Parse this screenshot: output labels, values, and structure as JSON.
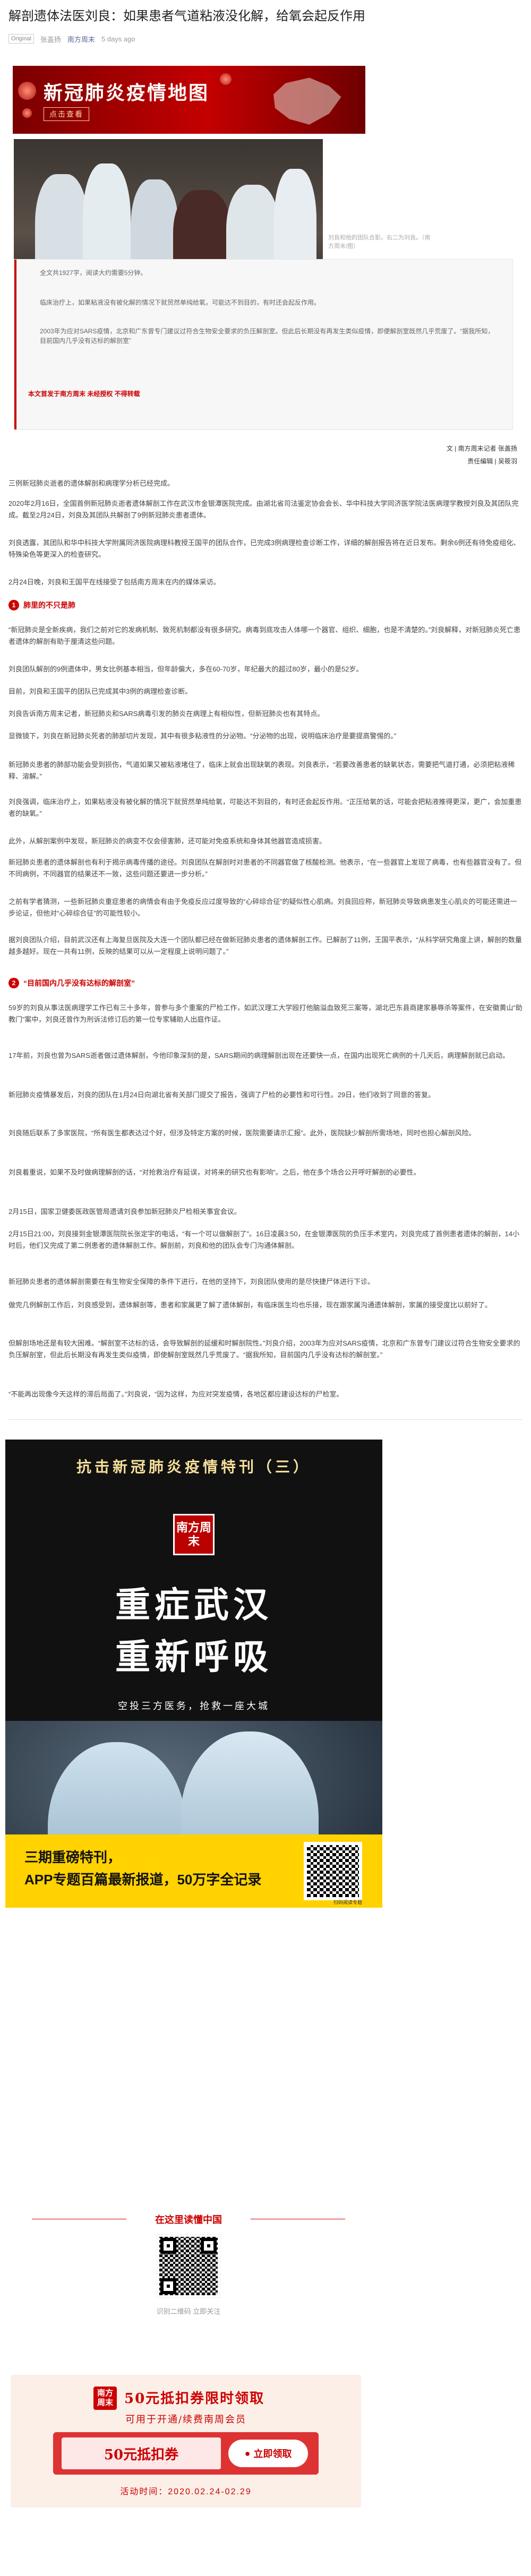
{
  "article": {
    "title": "解剖遗体法医刘良：如果患者气道粘液没化解，给氧会起反作用",
    "tag": "Original",
    "author": "张盖扬",
    "account": "南方周末",
    "time": "5 days ago"
  },
  "banner": {
    "title": "新冠肺炎疫情地图",
    "subtitle": "点击查看"
  },
  "photo_caption": "刘良和他的团队合影。右二为刘良。（南方周末/图）",
  "intro": {
    "line1": "全文共1927字，阅读大约需要5分钟。",
    "line2": "临床治疗上，如果粘液没有被化解的情况下就贸然单纯给氧，可能达不到目的，有时还会起反作用。",
    "line3": "2003年为应对SARS疫情，北京和广东曾专门建议过符合生物安全要求的负压解剖室。但此后长期没有再发生类似疫情，即便解剖室既然几乎荒废了。“据我所知，目前国内几乎没有达标的解剖室”",
    "notice": "本文首发于南方周末 未经授权 不得转载"
  },
  "byline": {
    "line1": "文 | 南方周末记者 张盖扬",
    "line2": "责任编辑 | 吴筱羽"
  },
  "paragraphs": [
    "三例新冠肺炎逝者的遗体解剖和病理学分析已经完成。",
    "2020年2月16日，全国首例新冠肺炎逝者遗体解剖工作在武汉市金银潭医院完成。由湖北省司法鉴定协会会长、华中科技大学同济医学院法医病理学教授刘良及其团队完成。截至2月24日，刘良及其团队共解剖了9例新冠肺炎患者遗体。",
    "刘良透露，其团队和华中科技大学附属同济医院病理科教授王国平的团队合作，已完成3例病理检查诊断工作，详细的解剖报告将在近日发布。剩余6例还有待免疫组化、特殊染色等更深入的检查研究。",
    "2月24日晚，刘良和王国平在线接受了包括南方周末在内的媒体采访。",
    "“新冠肺炎是全新疾病，我们之前对它的发病机制、致死机制都没有很多研究。病毒到底攻击人体哪一个器官、组织、细胞，也是不清楚的。”刘良解释，对新冠肺炎死亡患者遗体的解剖有助于厘清这些问题。",
    "刘良团队解剖的9例遗体中，男女比例基本相当，但年龄偏大，多在60-70岁，年纪最大的超过80岁，最小的是52岁。",
    "目前，刘良和王国平的团队已完成其中3例的病理检查诊断。",
    "刘良告诉南方周末记者，新冠肺炎和SARS病毒引发的肺炎在病理上有相似性，但新冠肺炎也有其特点。",
    "显微镜下，刘良在新冠肺炎死者的肺部切片发现，其中有很多粘液性的分泌物。“分泌物的出现，说明临床治疗是要提高警惕的。”",
    "新冠肺炎患者的肺部功能会受到损伤，气道如果又被粘液堵住了，临床上就会出现缺氧的表现。刘良表示，“若要改善患者的缺氧状态，需要把气道打通，必须把粘液稀释、溶解。”",
    "刘良强调，临床治疗上，如果粘液没有被化解的情况下就贸然单纯给氧，可能达不到目的，有时还会起反作用。“正压给氧的话，可能会把粘液推得更深，更广，会加重患者的缺氧。”",
    "此外，从解剖案例中发现，新冠肺炎的病变不仅会侵害肺，还可能对免疫系统和身体其他器官造成损害。",
    "新冠肺炎患者的遗体解剖也有利于揭示病毒传播的途径。刘良团队在解剖时对患者的不同器官做了核酸检测。他表示，“在一些器官上发现了病毒，也有些器官没有了。但不同病例，不同器官的结果还不一致，这些问题还要进一步分析。”",
    "之前有学者猜测，一些新冠肺炎重症患者的病情会有由于免疫反应过度导致的“心碎综合征”的疑似性心肌病。刘良回应称，新冠肺炎导致病患发生心肌炎的可能还需进一步论证，但他对“心碎综合征”的可能性较小。",
    "据刘良团队介绍，目前武汉还有上海复旦医院及大连一个团队都已经在做新冠肺炎患者的遗体解剖工作。已解剖了11例，王国平表示，“从科学研究角度上讲，解剖的数量越多越好。现在一共有11例，反映的结果可以从一定程度上说明问题了。”",
    "59岁的刘良从事法医病理学工作已有三十多年，曾参与多个重案的尸检工作，如武汉理工大学殴打他脑溢血致死三案等，湖北巴东县商建家暴辱杀等案件，在安徽黄山“助教门”案中，刘良还曾作为刑诉法修订后的第一位专家辅助人出庭作证。",
    "17年前，刘良也曾为SARS逝者做过遗体解剖，今他印象深刻的是，SARS期间的病理解剖出现在还要快一点，在国内出现死亡病例的十几天后，病理解剖就已启动。",
    "新冠肺炎疫情暴发后，刘良的团队在1月24日向湖北省有关部门提交了报告，强调了尸检的必要性和可行性。29日，他们收到了同意的答复。",
    "刘良随后联系了多家医院，“所有医生都表达过个好，但涉及特定方案的时候，医院需要请示汇报”。此外，医院缺少解剖所需场地，同时也担心解剖风险。",
    "刘良着重说，如果不及时做病理解剖的话，“对抢救治疗有延误，对将来的研究也有影响”。之后，他在多个场合公开呼吁解剖的必要性。",
    "2月15日，国家卫健委医政医管局遗请刘良参加新冠肺炎尸检相关事宜会议。",
    "2月15日21:00，刘良接到金银潭医院院长张定宇的电话，“有一个可以做解剖了”。16日凌晨3:50，在金银潭医院的负压手术室内，刘良完成了首例患者遗体的解剖，14小时后，他们又完成了第二例患者的遗体解剖工作。解剖前，刘良和他的团队会专门沟通体解剖。",
    "新冠肺炎患者的遗体解剖需要在有生物安全保障的条件下进行，在他的坚持下，刘良团队使用的是尽快捷尸体进行下诊。",
    "做完几例解剖工作后，刘良感受到，遗体解剖等，患者和家属更了解了遗体解剖，有临床医生均也乐接，现在跟家属沟通遗体解剖，家属的接受度比以前好了。",
    "但解剖场地还是有较大困难。“解剖室不达标的话，会导致解剖的延缓和时解剖院性。”刘良介绍，2003年为应对SARS疫情，北京和广东曾专门建议过符合生物安全要求的负压解剖室，但此后长期没有再发生类似疫情，即使解剖室既然几乎荒废了。“据我所知，目前国内几乎没有达标的解剖室。”",
    "“不能再出现像今天这样的滞后局面了。”刘良说，“因为这样，为应对突发疫情，各地区都应建设达标的尸检室。"
  ],
  "sections": [
    {
      "num": "1",
      "label": "肺里的不只是肺"
    },
    {
      "num": "2",
      "label": "“目前国内几乎没有达标的解剖室”"
    }
  ],
  "poster": {
    "band": "抗击新冠肺炎疫情特刊（三）",
    "seal": "南方周末",
    "big1": "重症武汉",
    "big2": "重新呼吸",
    "sub": "空投三方医务，抢救一座大城",
    "yellow1": "三期重磅特刊，",
    "yellow2": "APP专题百篇最新报道，50万字全记录",
    "qr_caption": "扫码阅读专题"
  },
  "follow": {
    "title": "在这里读懂中国",
    "hint": "识别二维码 立即关注"
  },
  "coupon": {
    "logo": "南方周末",
    "title": "50元抵扣券限时领取",
    "subtitle": "可用于开通/续费南周会员",
    "ticket": "50元抵扣券",
    "button": "立即领取",
    "time": "活动时间：2020.02.24-02.29"
  }
}
